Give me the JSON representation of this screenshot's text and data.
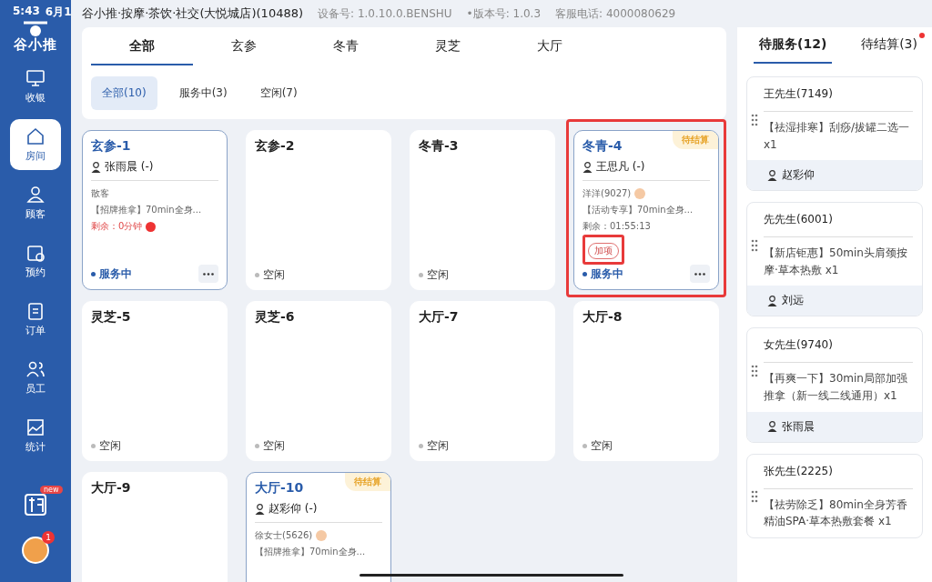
{
  "status_bar": {
    "time": "5:43",
    "date": "6月1",
    "store": "谷小推·按摩·茶饮·社交(大悦城店)(10488)",
    "device": "设备号: 1.0.10.0.BENSHU",
    "version": "•版本号:  1.0.3",
    "hotline": "客服电话:  4000080629"
  },
  "sidebar": {
    "logo": "谷小推",
    "items": [
      {
        "label": "收银",
        "selected": false
      },
      {
        "label": "房间",
        "selected": true
      },
      {
        "label": "顾客",
        "selected": false
      },
      {
        "label": "预约",
        "selected": false
      },
      {
        "label": "订单",
        "selected": false
      },
      {
        "label": "员工",
        "selected": false
      },
      {
        "label": "统计",
        "selected": false
      }
    ],
    "new_badge": "new",
    "avatar_badge": "1"
  },
  "area_tabs": [
    {
      "label": "全部",
      "selected": true
    },
    {
      "label": "玄参",
      "selected": false
    },
    {
      "label": "冬青",
      "selected": false
    },
    {
      "label": "灵芝",
      "selected": false
    },
    {
      "label": "大厅",
      "selected": false
    }
  ],
  "filters": [
    {
      "label": "全部(10)",
      "selected": true
    },
    {
      "label": "服务中(3)",
      "selected": false
    },
    {
      "label": "空闲(7)",
      "selected": false
    }
  ],
  "rooms": [
    {
      "kind": "busy",
      "name": "玄参-1",
      "therapist": "张雨晨 (-)",
      "customer": "散客",
      "service": "【招牌推拿】70min全身...",
      "remaining": "剩余：0分钟",
      "overdue": true,
      "status": "服务中"
    },
    {
      "kind": "idle",
      "name": "玄参-2",
      "status": "空闲"
    },
    {
      "kind": "idle",
      "name": "冬青-3",
      "status": "空闲"
    },
    {
      "kind": "busy",
      "name": "冬青-4",
      "badge": "待结算",
      "therapist": "王思凡 (-)",
      "customer": "洋洋(9027)",
      "vip": true,
      "service": "【活动专享】70min全身...",
      "remaining": "剩余：01:55:13",
      "overdue": false,
      "add_tag": "加项",
      "status": "服务中",
      "highlighted": true
    },
    {
      "kind": "idle",
      "name": "灵芝-5",
      "status": "空闲"
    },
    {
      "kind": "idle",
      "name": "灵芝-6",
      "status": "空闲"
    },
    {
      "kind": "idle",
      "name": "大厅-7",
      "status": "空闲"
    },
    {
      "kind": "idle",
      "name": "大厅-8",
      "status": "空闲"
    },
    {
      "kind": "idle",
      "name": "大厅-9"
    },
    {
      "kind": "busy",
      "name": "大厅-10",
      "badge": "待结算",
      "therapist": "赵彩仰 (-)",
      "customer": "徐女士(5626)",
      "vip": true,
      "service": "【招牌推拿】70min全身..."
    }
  ],
  "queue_tabs": [
    {
      "label": "待服务(12)",
      "selected": true,
      "dot": false
    },
    {
      "label": "待结算(3)",
      "selected": false,
      "dot": true
    }
  ],
  "queue": [
    {
      "customer": "王先生(7149)",
      "service": "【祛湿排寒】刮痧/拔罐二选一 x1",
      "therapist": "赵彩仰"
    },
    {
      "customer": "先先生(6001)",
      "service": "【新店钜惠】50min头肩颈按摩·草本热敷 x1",
      "therapist": "刘远"
    },
    {
      "customer": "女先生(9740)",
      "service": "【再爽一下】30min局部加强推拿（新一线二线通用）x1",
      "therapist": "张雨晨"
    },
    {
      "customer": "张先生(2225)",
      "service": "【祛劳除乏】80min全身芳香精油SPA·草本热敷套餐 x1"
    }
  ]
}
